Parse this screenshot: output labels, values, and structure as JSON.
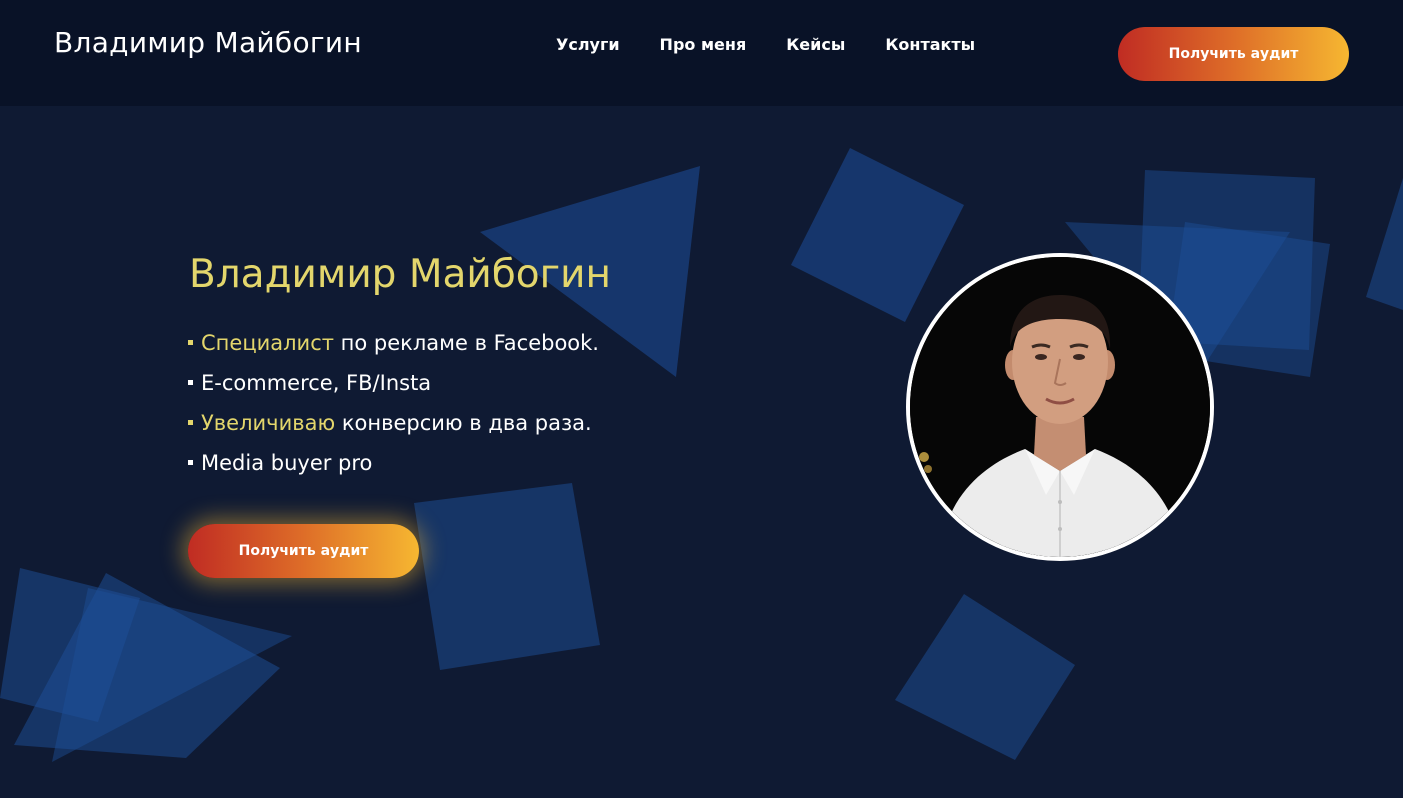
{
  "header": {
    "brand": "Владимир Майбогин",
    "nav": [
      "Услуги",
      "Про меня",
      "Кейсы",
      "Контакты"
    ],
    "cta_label": "Получить аудит"
  },
  "hero": {
    "title": "Владимир Майбогин",
    "bullets": [
      {
        "highlight": "Специалист",
        "rest": " по рекламе в Facebook."
      },
      {
        "highlight": "",
        "rest": "E-commerce, FB/Insta"
      },
      {
        "highlight": "Увеличиваю",
        "rest": " конверсию в два раза."
      },
      {
        "highlight": "",
        "rest": "Media buyer pro"
      }
    ],
    "cta_label": "Получить аудит",
    "avatar_icon": "portrait-photo"
  },
  "colors": {
    "background": "#0f1a33",
    "header_bg": "#091227",
    "accent_yellow": "#e3d66c",
    "cta_start": "#c02c23",
    "cta_end": "#f6b731",
    "shape_blue": "#1d4f9a"
  }
}
